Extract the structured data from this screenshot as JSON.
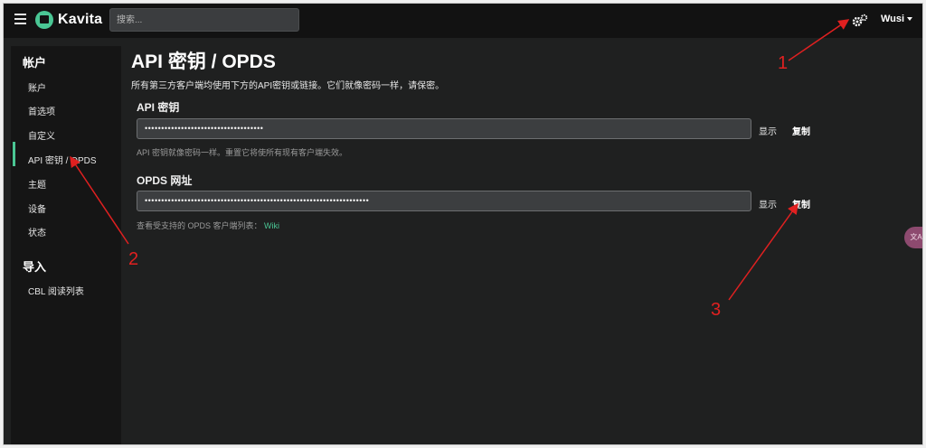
{
  "nav": {
    "brand": "Kavita",
    "search_placeholder": "搜索...",
    "user": "Wusi",
    "icons": {
      "menu": "hamburger-icon",
      "logo": "kavita-logo-icon",
      "settings": "gear-icon",
      "dropdown": "chevron-down-icon"
    }
  },
  "sidebar": {
    "account_header": "帐户",
    "account_items": [
      {
        "label": "账户"
      },
      {
        "label": "首选项"
      },
      {
        "label": "自定义"
      },
      {
        "label": "API 密钥 / OPDS",
        "active": true
      },
      {
        "label": "主题"
      },
      {
        "label": "设备"
      },
      {
        "label": "状态"
      }
    ],
    "import_header": "导入",
    "import_items": [
      {
        "label": "CBL 阅读列表"
      }
    ],
    "accent": "#4ac694"
  },
  "main": {
    "title": "API 密钥 / OPDS",
    "description": "所有第三方客户端均使用下方的API密钥或链接。它们就像密码一样，请保密。",
    "api": {
      "label": "API 密钥",
      "value": "••••••••••••••••••••••••••••••••••••",
      "show": "显示",
      "copy": "复制",
      "hint": "API 密钥就像密码一样。重置它将使所有现有客户端失效。"
    },
    "opds": {
      "label": "OPDS 网址",
      "value": "••••••••••••••••••••••••••••••••••••••••••••••••••••••••••••••••••••",
      "show": "显示",
      "copy": "复制",
      "hint": "查看受支持的 OPDS 客户端列表：",
      "hint_link": "Wiki"
    }
  },
  "floating": {
    "translate_label": "文A",
    "icon": "translate-icon"
  },
  "annotations": {
    "one": "1",
    "two": "2",
    "three": "3",
    "color": "#e02020"
  }
}
